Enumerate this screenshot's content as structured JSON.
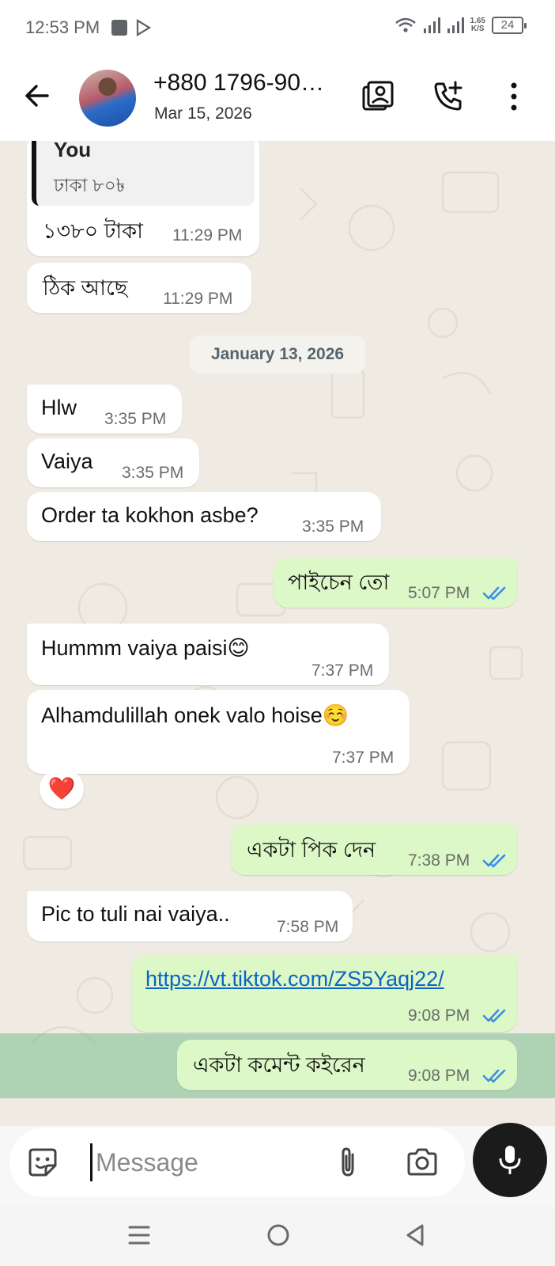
{
  "status_bar": {
    "time": "12:53 PM",
    "net_speed_value": "1.65",
    "net_speed_unit": "K/S",
    "battery": "24"
  },
  "header": {
    "contact_name": "+880 1796-90…",
    "subtitle": "Mar 15, 2026",
    "icons": [
      "back-arrow-icon",
      "contact-card-icon",
      "add-call-icon",
      "more-vert-icon"
    ]
  },
  "chat": {
    "quoted": {
      "author": "You",
      "text": "ঢাকা ৮০৳"
    },
    "messages": [
      {
        "dir": "in",
        "text": "১৩৮০ টাকা",
        "time": "11:29 PM"
      },
      {
        "dir": "in",
        "text": "ঠিক আছে",
        "time": "11:29 PM"
      },
      {
        "dir": "in",
        "text": "Hlw",
        "time": "3:35 PM"
      },
      {
        "dir": "in",
        "text": "Vaiya",
        "time": "3:35 PM"
      },
      {
        "dir": "in",
        "text": "Order ta kokhon asbe?",
        "time": "3:35 PM"
      },
      {
        "dir": "out",
        "text": "পাইচেন তো",
        "time": "5:07 PM"
      },
      {
        "dir": "in",
        "text": "Hummm vaiya paisi😊",
        "time": "7:37 PM"
      },
      {
        "dir": "in",
        "text": "Alhamdulillah onek valo hoise☺️",
        "time": "7:37 PM"
      },
      {
        "dir": "out",
        "text": "একটা পিক দেন",
        "time": "7:38 PM"
      },
      {
        "dir": "in",
        "text": "Pic to tuli nai vaiya..",
        "time": "7:58 PM"
      },
      {
        "dir": "out",
        "text": "https://vt.tiktok.com/ZS5Yaqj22/",
        "time": "9:08 PM"
      },
      {
        "dir": "out",
        "text": "একটা কমেন্ট কইরেন",
        "time": "9:08 PM"
      }
    ],
    "date_divider": "January 13, 2026",
    "reaction": "❤️"
  },
  "composer": {
    "placeholder": "Message",
    "icons": [
      "sticker-icon",
      "attach-icon",
      "camera-icon",
      "mic-icon"
    ]
  },
  "nav_bar": {
    "icons": [
      "recents-icon",
      "home-icon",
      "back-icon"
    ]
  },
  "colors": {
    "chat_bg": "#efeae2",
    "incoming_bubble": "#ffffff",
    "outgoing_bubble": "#dcf8c6",
    "read_tick": "#3b8ee8",
    "link": "#0b63c5"
  }
}
